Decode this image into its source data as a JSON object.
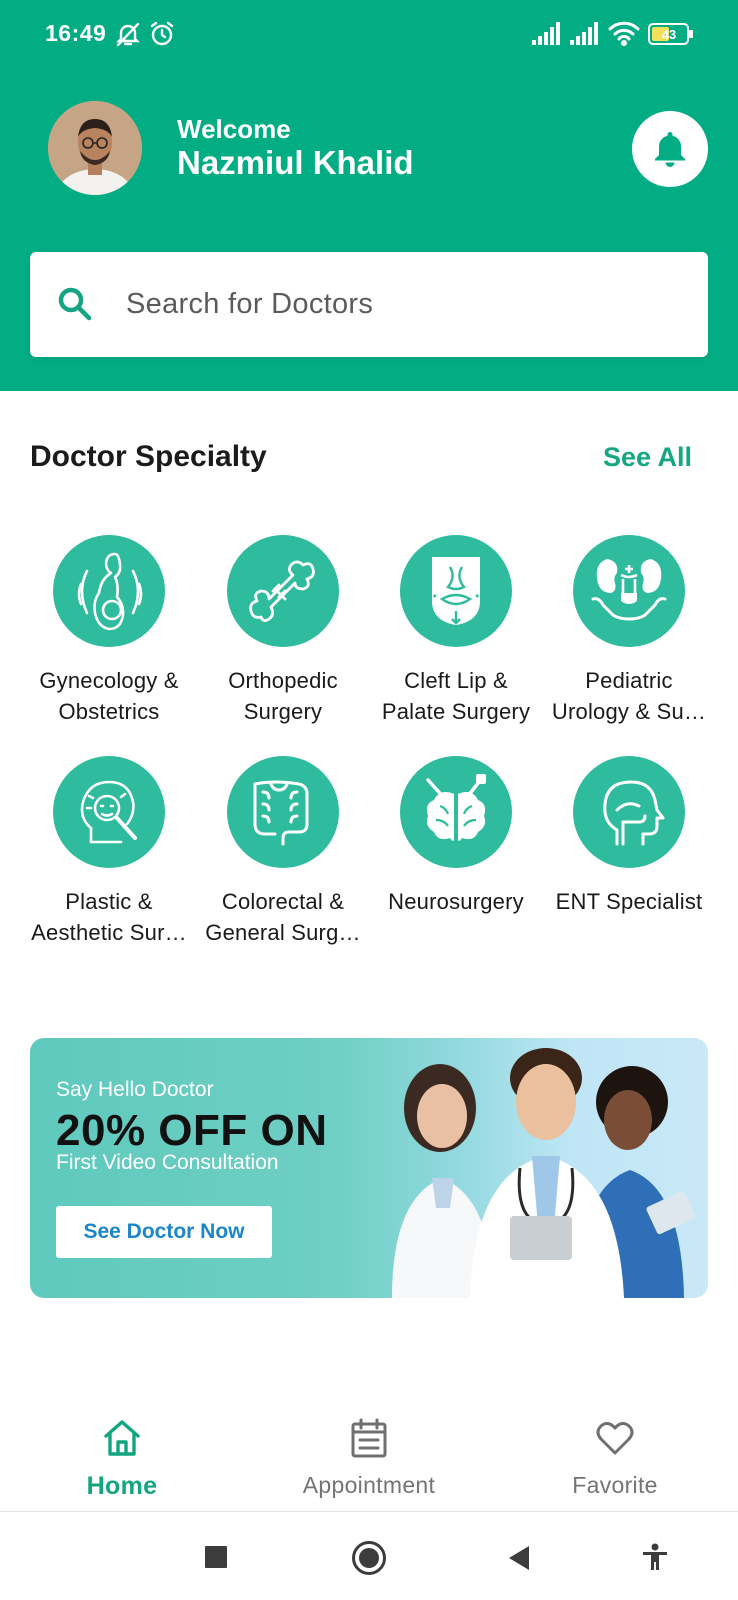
{
  "status_bar": {
    "time": "16:49",
    "battery": "43"
  },
  "header": {
    "welcome": "Welcome",
    "user_name": "Nazmiul Khalid"
  },
  "search": {
    "placeholder": "Search for Doctors"
  },
  "specialty_section": {
    "title": "Doctor Specialty",
    "see_all": "See All",
    "items": [
      {
        "line1": "Gynecology &",
        "line2": "Obstetrics",
        "icon": "pregnancy-icon"
      },
      {
        "line1": "Orthopedic",
        "line2": "Surgery",
        "icon": "bone-icon"
      },
      {
        "line1": "Cleft Lip &",
        "line2": "Palate Surgery",
        "icon": "face-surgery-icon"
      },
      {
        "line1": "Pediatric",
        "line2": "Urology & Su…",
        "icon": "kidney-icon"
      },
      {
        "line1": "Plastic &",
        "line2": "Aesthetic Sur…",
        "icon": "aesthetic-icon"
      },
      {
        "line1": "Colorectal &",
        "line2": "General Surg…",
        "icon": "colon-icon"
      },
      {
        "line1": "Neurosurgery",
        "line2": "",
        "icon": "brain-icon"
      },
      {
        "line1": "ENT Specialist",
        "line2": "",
        "icon": "ent-head-icon"
      }
    ]
  },
  "promo": {
    "eyebrow": "Say Hello Doctor",
    "headline": "20% OFF ON",
    "subtitle": "First Video Consultation",
    "button": "See Doctor Now"
  },
  "bottom_nav": {
    "items": [
      {
        "label": "Home",
        "active": true
      },
      {
        "label": "Appointment",
        "active": false
      },
      {
        "label": "Favorite",
        "active": false
      }
    ]
  },
  "colors": {
    "primary": "#02ad84",
    "icon_bg": "#2ebb9e",
    "link": "#16a683",
    "promo_button_text": "#1b86c9"
  }
}
